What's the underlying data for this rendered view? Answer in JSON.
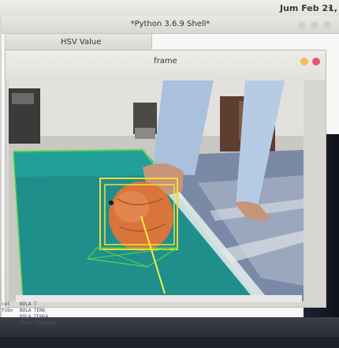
{
  "topbar": {
    "clock": "Jum Feb 21, 1",
    "arrow": "▾"
  },
  "shell": {
    "title": "*Python 3.6.9 Shell*"
  },
  "hsv_window": {
    "title": "HSV Value"
  },
  "frame_window": {
    "title": "frame"
  },
  "console": {
    "lines": [
      {
        "left": "cet",
        "right": "BOLA T"
      },
      {
        "left": "fobo",
        "right": "BOLA TENG"
      },
      {
        "left": "",
        "right": "BOLA TENGA"
      },
      {
        "left": "",
        "right": "BOLA TENGEHAT"
      }
    ]
  },
  "colors": {
    "field": "#1f8f8c",
    "field_line": "#5ad24a",
    "ball": "#d9743a",
    "box_outer": "#f2d93a",
    "box_inner": "#f3e23c",
    "aim_line": "#f7ef3b"
  }
}
